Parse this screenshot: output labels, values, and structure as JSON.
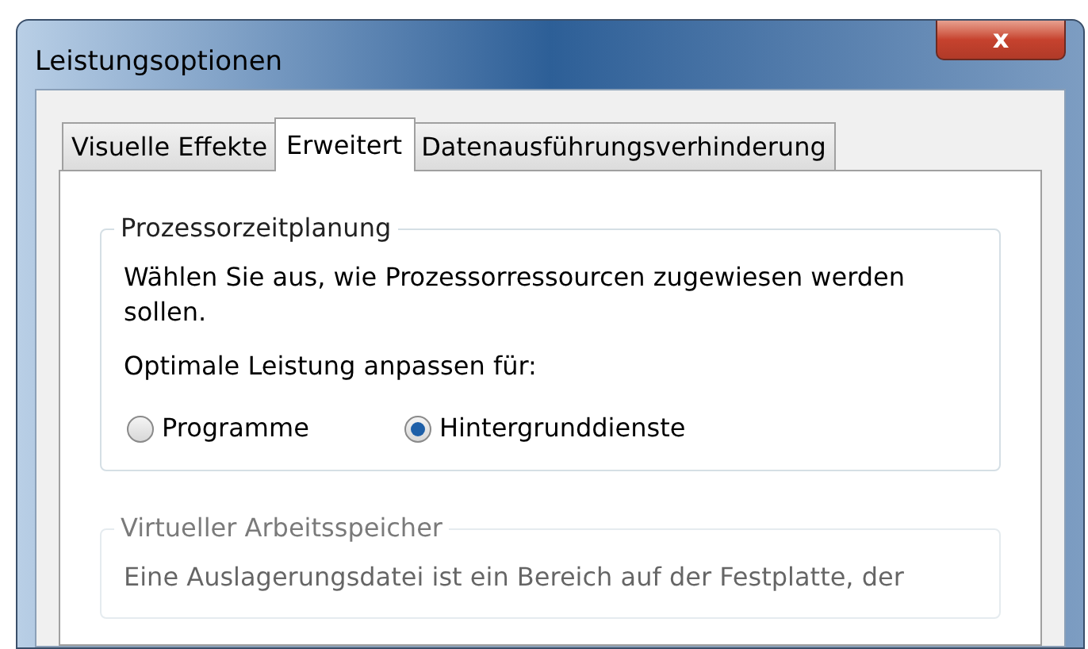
{
  "window": {
    "title": "Leistungsoptionen",
    "close_label": "x"
  },
  "tabs": [
    {
      "label": "Visuelle Effekte",
      "selected": false
    },
    {
      "label": "Erweitert",
      "selected": true
    },
    {
      "label": "Datenausführungsverhinderung",
      "selected": false
    }
  ],
  "groups": [
    {
      "title": "Prozessorzeitplanung",
      "texts": [
        "Wählen Sie aus, wie Prozessorressourcen zugewiesen werden sollen.",
        "Optimale Leistung anpassen für:"
      ],
      "radios": [
        {
          "label": "Programme",
          "selected": false
        },
        {
          "label": "Hintergrunddienste",
          "selected": true
        }
      ]
    },
    {
      "title": "Virtueller Arbeitsspeicher",
      "texts": [
        "Eine Auslagerungsdatei ist ein Bereich auf der Festplatte, der"
      ]
    }
  ]
}
